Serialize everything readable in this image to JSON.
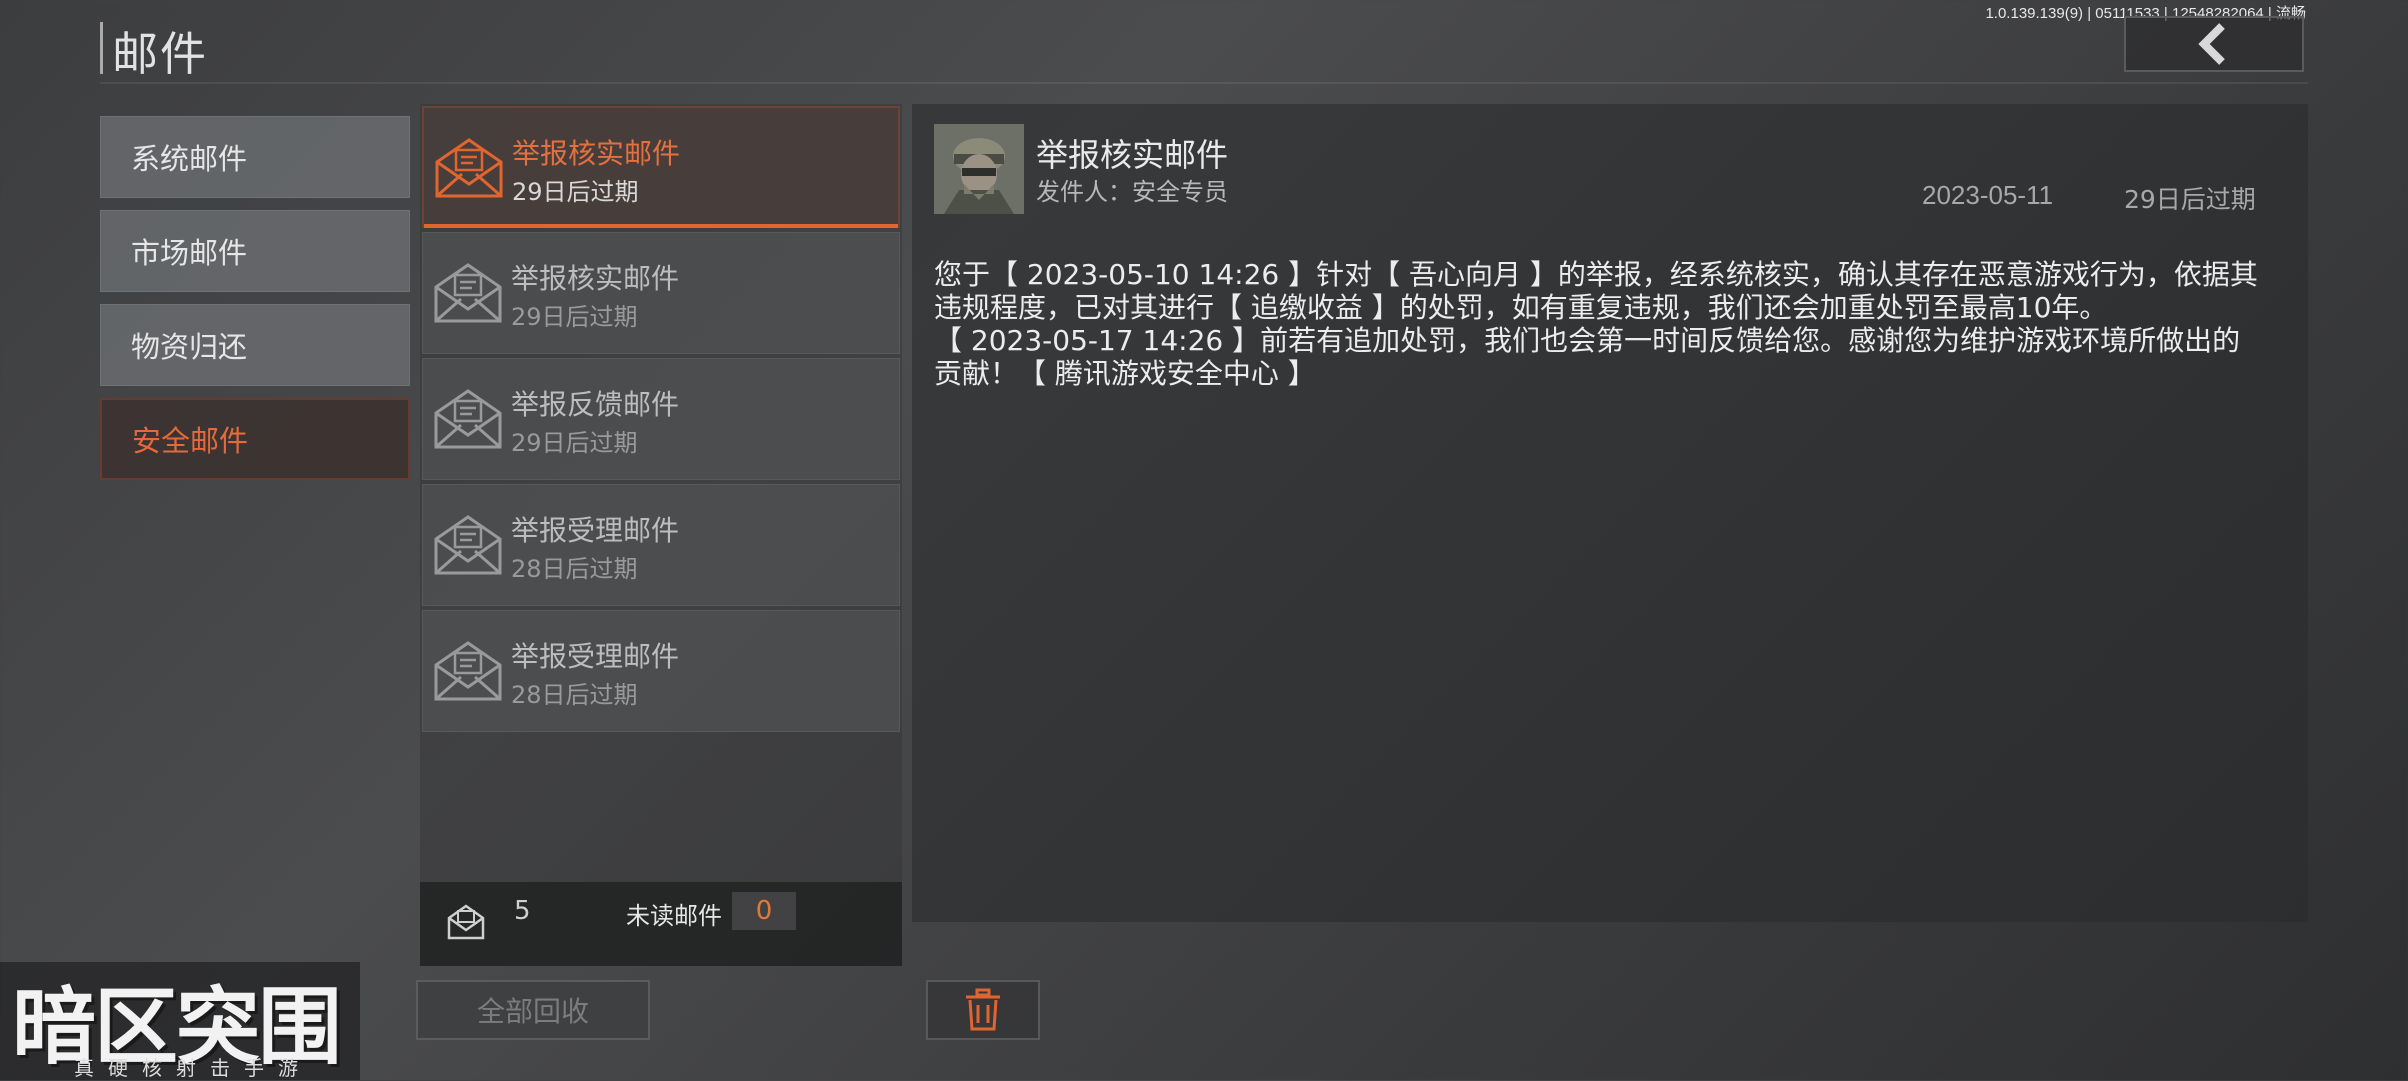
{
  "header": {
    "title": "邮件",
    "build_info": "1.0.139.139(9) | 05111533 | 12548282064 | 流畅"
  },
  "categories": [
    {
      "label": "系统邮件"
    },
    {
      "label": "市场邮件"
    },
    {
      "label": "物资归还"
    },
    {
      "label": "安全邮件"
    }
  ],
  "mails": [
    {
      "subject": "举报核实邮件",
      "expire": "29日后过期"
    },
    {
      "subject": "举报核实邮件",
      "expire": "29日后过期"
    },
    {
      "subject": "举报反馈邮件",
      "expire": "29日后过期"
    },
    {
      "subject": "举报受理邮件",
      "expire": "28日后过期"
    },
    {
      "subject": "举报受理邮件",
      "expire": "28日后过期"
    }
  ],
  "list_footer": {
    "count": "5",
    "unread_label": "未读邮件",
    "unread_count": "0",
    "collect_all_label": "全部回收"
  },
  "detail": {
    "subject": "举报核实邮件",
    "sender": "发件人：安全专员",
    "date": "2023-05-11",
    "expire": "29日后过期",
    "body_line1": "您于【 2023-05-10 14:26 】针对【 吾心向月 】的举报，经系统核实，确认其存在恶意游戏行为，依据其",
    "body_line2": "违规程度，已对其进行【 追缴收益 】的处罚，如有重复违规，我们还会加重处罚至最高10年。",
    "body_line3": "【 2023-05-17 14:26 】前若有追加处罚，我们也会第一时间反馈给您。感谢您为维护游戏环境所做出的",
    "body_line4": "贡献！【 腾讯游戏安全中心 】"
  },
  "logo": {
    "main": "暗区突围",
    "sub": "真硬核射击手游"
  },
  "colors": {
    "accent": "#e0652f",
    "background": "#3c3d3f"
  },
  "icons": [
    "back-chevron-icon",
    "envelope-icon",
    "mail-count-icon",
    "trash-icon"
  ]
}
